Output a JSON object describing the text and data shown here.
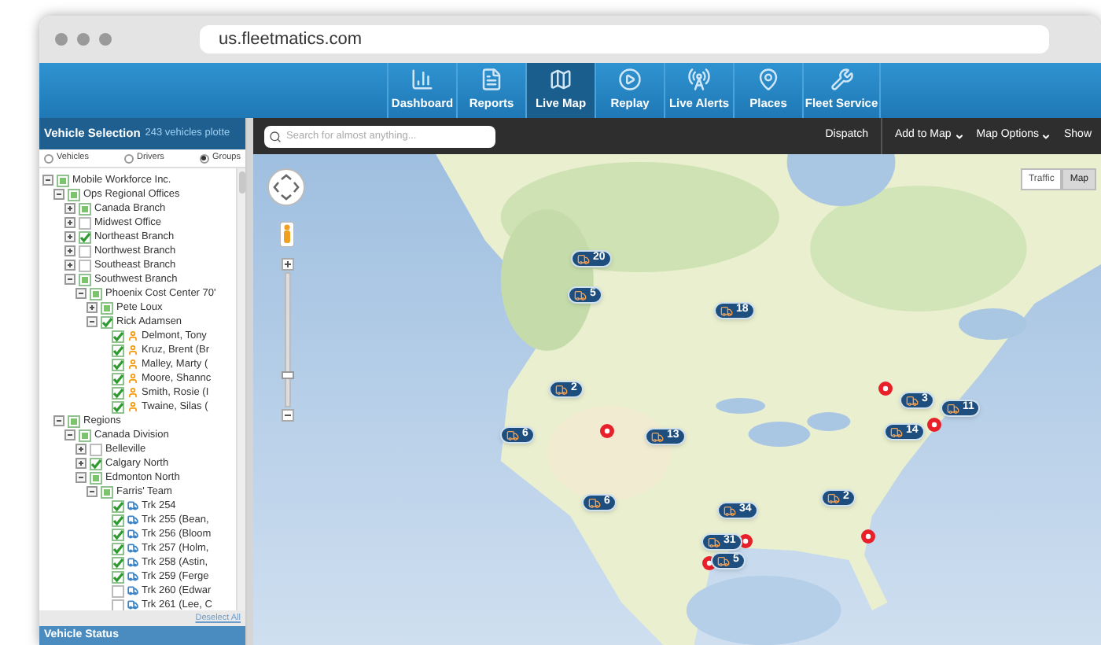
{
  "browser": {
    "url": "us.fleetmatics.com"
  },
  "nav": [
    {
      "label": "Dashboard",
      "selected": false
    },
    {
      "label": "Reports",
      "selected": false
    },
    {
      "label": "Live Map",
      "selected": true
    },
    {
      "label": "Replay",
      "selected": false
    },
    {
      "label": "Live Alerts",
      "selected": false
    },
    {
      "label": "Places",
      "selected": false
    },
    {
      "label": "Fleet Service",
      "selected": false
    }
  ],
  "sidebar": {
    "title": "Vehicle Selection",
    "subtitle": "243 vehicles plotte",
    "views": [
      {
        "label": "Vehicles",
        "selected": false
      },
      {
        "label": "Drivers",
        "selected": false
      },
      {
        "label": "Groups",
        "selected": true
      }
    ],
    "tree": [
      {
        "label": "Mobile Workforce Inc.",
        "checked": false,
        "mixed": true,
        "kind": "group",
        "expanded": true,
        "children": [
          {
            "label": "Ops Regional Offices",
            "checked": false,
            "mixed": true,
            "kind": "group",
            "expanded": true,
            "children": [
              {
                "label": "Canada Branch",
                "checked": false,
                "mixed": true,
                "kind": "group",
                "expanded": false
              },
              {
                "label": "Midwest Office",
                "checked": false,
                "mixed": false,
                "kind": "group",
                "expanded": false
              },
              {
                "label": "Northeast Branch",
                "checked": true,
                "mixed": false,
                "kind": "group",
                "expanded": false
              },
              {
                "label": "Northwest Branch",
                "checked": false,
                "mixed": false,
                "kind": "group",
                "expanded": false
              },
              {
                "label": "Southeast Branch",
                "checked": false,
                "mixed": false,
                "kind": "group",
                "expanded": false
              },
              {
                "label": "Southwest Branch",
                "checked": false,
                "mixed": true,
                "kind": "group",
                "expanded": true,
                "children": [
                  {
                    "label": "Phoenix Cost Center 70'",
                    "checked": false,
                    "mixed": true,
                    "kind": "group",
                    "expanded": true,
                    "children": [
                      {
                        "label": "Pete Loux",
                        "checked": false,
                        "mixed": true,
                        "kind": "group",
                        "expanded": false
                      },
                      {
                        "label": "Rick Adamsen",
                        "checked": true,
                        "mixed": false,
                        "kind": "group",
                        "expanded": true,
                        "children": [
                          {
                            "label": "Delmont, Tony",
                            "checked": true,
                            "mixed": false,
                            "kind": "driver"
                          },
                          {
                            "label": "Kruz, Brent (Br",
                            "checked": true,
                            "mixed": false,
                            "kind": "driver"
                          },
                          {
                            "label": "Malley, Marty (",
                            "checked": true,
                            "mixed": false,
                            "kind": "driver"
                          },
                          {
                            "label": "Moore, Shannc",
                            "checked": true,
                            "mixed": false,
                            "kind": "driver"
                          },
                          {
                            "label": "Smith, Rosie (I",
                            "checked": true,
                            "mixed": false,
                            "kind": "driver"
                          },
                          {
                            "label": "Twaine, Silas (",
                            "checked": true,
                            "mixed": false,
                            "kind": "driver"
                          }
                        ]
                      }
                    ]
                  }
                ]
              }
            ]
          },
          {
            "label": "Regions",
            "checked": false,
            "mixed": true,
            "kind": "group",
            "expanded": true,
            "children": [
              {
                "label": "Canada Division",
                "checked": false,
                "mixed": true,
                "kind": "group",
                "expanded": true,
                "children": [
                  {
                    "label": "Belleville",
                    "checked": false,
                    "mixed": false,
                    "kind": "group",
                    "expanded": false
                  },
                  {
                    "label": "Calgary North",
                    "checked": true,
                    "mixed": false,
                    "kind": "group",
                    "expanded": false
                  },
                  {
                    "label": "Edmonton North",
                    "checked": false,
                    "mixed": true,
                    "kind": "group",
                    "expanded": true,
                    "children": [
                      {
                        "label": "Farris' Team",
                        "checked": false,
                        "mixed": true,
                        "kind": "group",
                        "expanded": true,
                        "children": [
                          {
                            "label": "Trk 254",
                            "checked": true,
                            "mixed": false,
                            "kind": "vehicle"
                          },
                          {
                            "label": "Trk 255 (Bean,",
                            "checked": true,
                            "mixed": false,
                            "kind": "vehicle"
                          },
                          {
                            "label": "Trk 256 (Bloom",
                            "checked": true,
                            "mixed": false,
                            "kind": "vehicle"
                          },
                          {
                            "label": "Trk 257 (Holm,",
                            "checked": true,
                            "mixed": false,
                            "kind": "vehicle"
                          },
                          {
                            "label": "Trk 258 (Astin,",
                            "checked": true,
                            "mixed": false,
                            "kind": "vehicle"
                          },
                          {
                            "label": "Trk 259 (Ferge",
                            "checked": true,
                            "mixed": false,
                            "kind": "vehicle"
                          },
                          {
                            "label": "Trk 260 (Edwar",
                            "checked": false,
                            "mixed": false,
                            "kind": "vehicle"
                          },
                          {
                            "label": "Trk 261 (Lee, C",
                            "checked": false,
                            "mixed": false,
                            "kind": "vehicle"
                          }
                        ]
                      }
                    ]
                  }
                ]
              }
            ]
          }
        ]
      }
    ],
    "deselect_link": "Deselect All",
    "status_title": "Vehicle Status"
  },
  "toolbar": {
    "search": {
      "placeholder": "Search for almost anything..."
    },
    "actions": [
      {
        "label": "Dispatch",
        "kind": "plain"
      },
      {
        "label": "Add to Map",
        "kind": "menu"
      },
      {
        "label": "Map Options",
        "kind": "menu"
      },
      {
        "label": "Show",
        "kind": "plain"
      }
    ]
  },
  "map": {
    "zoom": {
      "level": 0.22
    },
    "map_type_buttons": [
      {
        "label": "Traffic",
        "selected": false
      },
      {
        "label": "Map",
        "selected": true
      }
    ],
    "markers": [
      {
        "count": "20"
      },
      {
        "count": "5"
      },
      {
        "count": "18"
      },
      {
        "count": "2"
      },
      {
        "count": "6"
      },
      {
        "count": "13"
      },
      {
        "count": "6"
      },
      {
        "count": "34"
      },
      {
        "count": "31"
      },
      {
        "count": "5"
      },
      {
        "count": "2"
      },
      {
        "count": "3"
      },
      {
        "count": "11"
      },
      {
        "count": "14"
      }
    ]
  }
}
